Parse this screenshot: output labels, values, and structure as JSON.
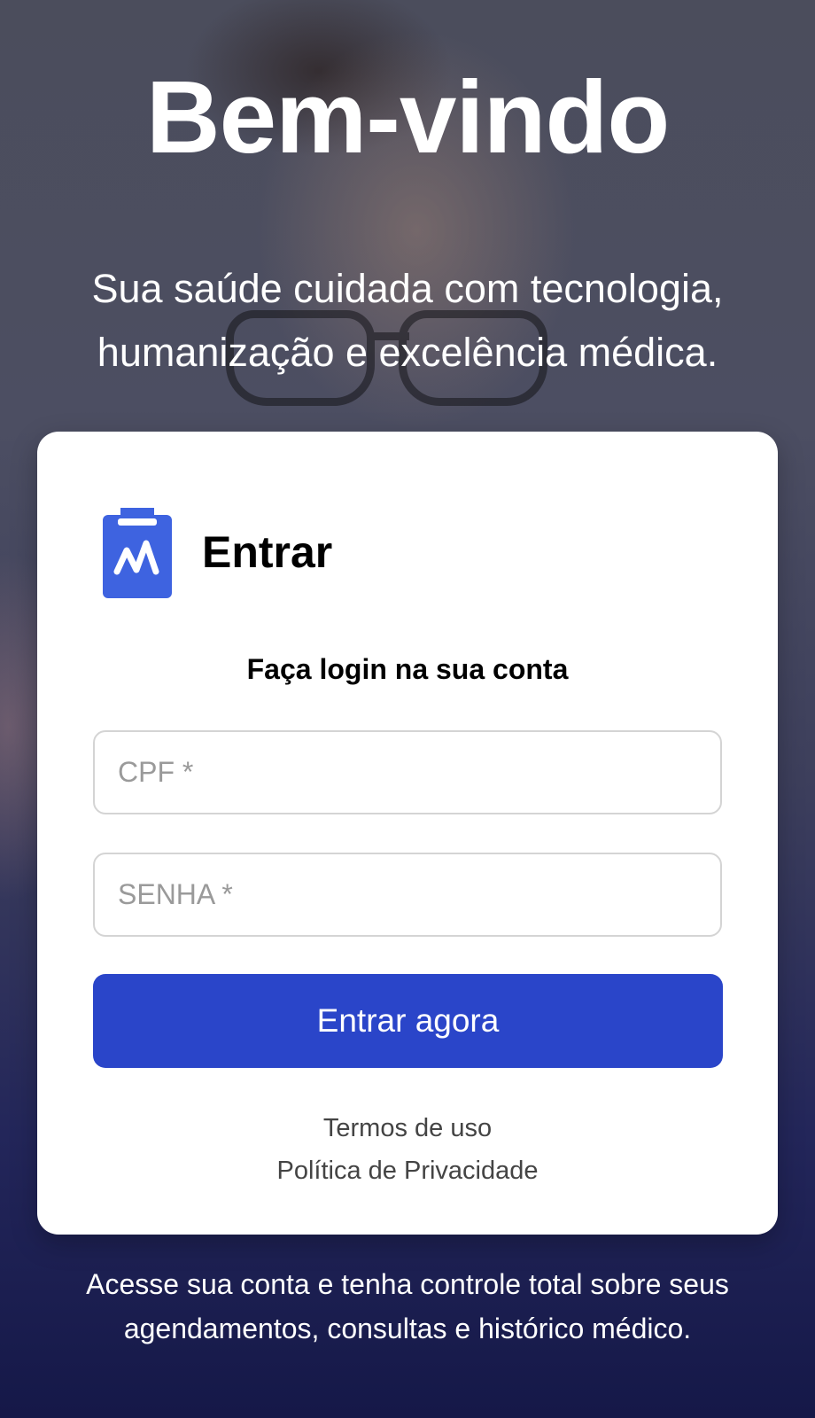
{
  "hero": {
    "title": "Bem-vindo",
    "subtitle_line1": "Sua saúde cuidada com tecnologia,",
    "subtitle_line2": "humanização e excelência médica."
  },
  "login_card": {
    "icon": "medical-clipboard-icon",
    "title": "Entrar",
    "subtitle": "Faça login na sua conta",
    "cpf_placeholder": "CPF *",
    "cpf_value": "",
    "password_placeholder": "SENHA *",
    "password_value": "",
    "submit_label": "Entrar agora",
    "terms_link": "Termos de uso",
    "privacy_link": "Política de Privacidade"
  },
  "footer": {
    "line1": "Acesse sua conta e tenha controle total sobre seus",
    "line2": "agendamentos, consultas e histórico médico."
  },
  "colors": {
    "primary": "#2a45c9",
    "icon": "#3e63e0",
    "card_background": "#ffffff",
    "overlay_dark": "#151848"
  }
}
